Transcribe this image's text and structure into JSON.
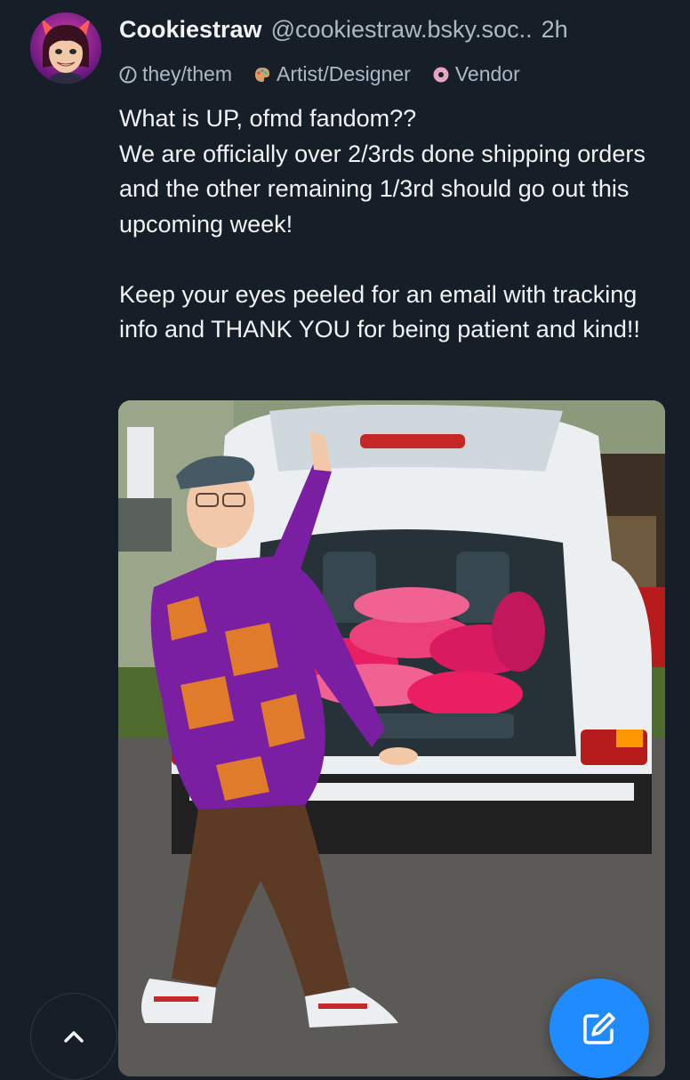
{
  "post": {
    "author": {
      "display_name": "Cookiestraw",
      "handle": "@cookiestraw.bsky.soc..",
      "time_ago": "2h"
    },
    "labels": [
      {
        "text": "they/them",
        "icon": "info-circle-icon"
      },
      {
        "text": "Artist/Designer",
        "icon": "palette-icon"
      },
      {
        "text": "Vendor",
        "icon": "donut-icon"
      }
    ],
    "text_lines": [
      "What is UP, ofmd fandom??",
      "We are officially over 2/3rds done shipping orders and the other remaining 1/3rd should go out this upcoming week!",
      "Keep your eyes peeled for an email with tracking info and THANK YOU for being patient and kind!!"
    ]
  },
  "controls": {
    "scroll_top_icon": "chevron-up-icon",
    "compose_icon": "compose-pencil-icon"
  },
  "colors": {
    "background": "#161e27",
    "text_primary": "#f1f3f5",
    "text_secondary": "#aeb9c6",
    "accent": "#208bfe"
  }
}
